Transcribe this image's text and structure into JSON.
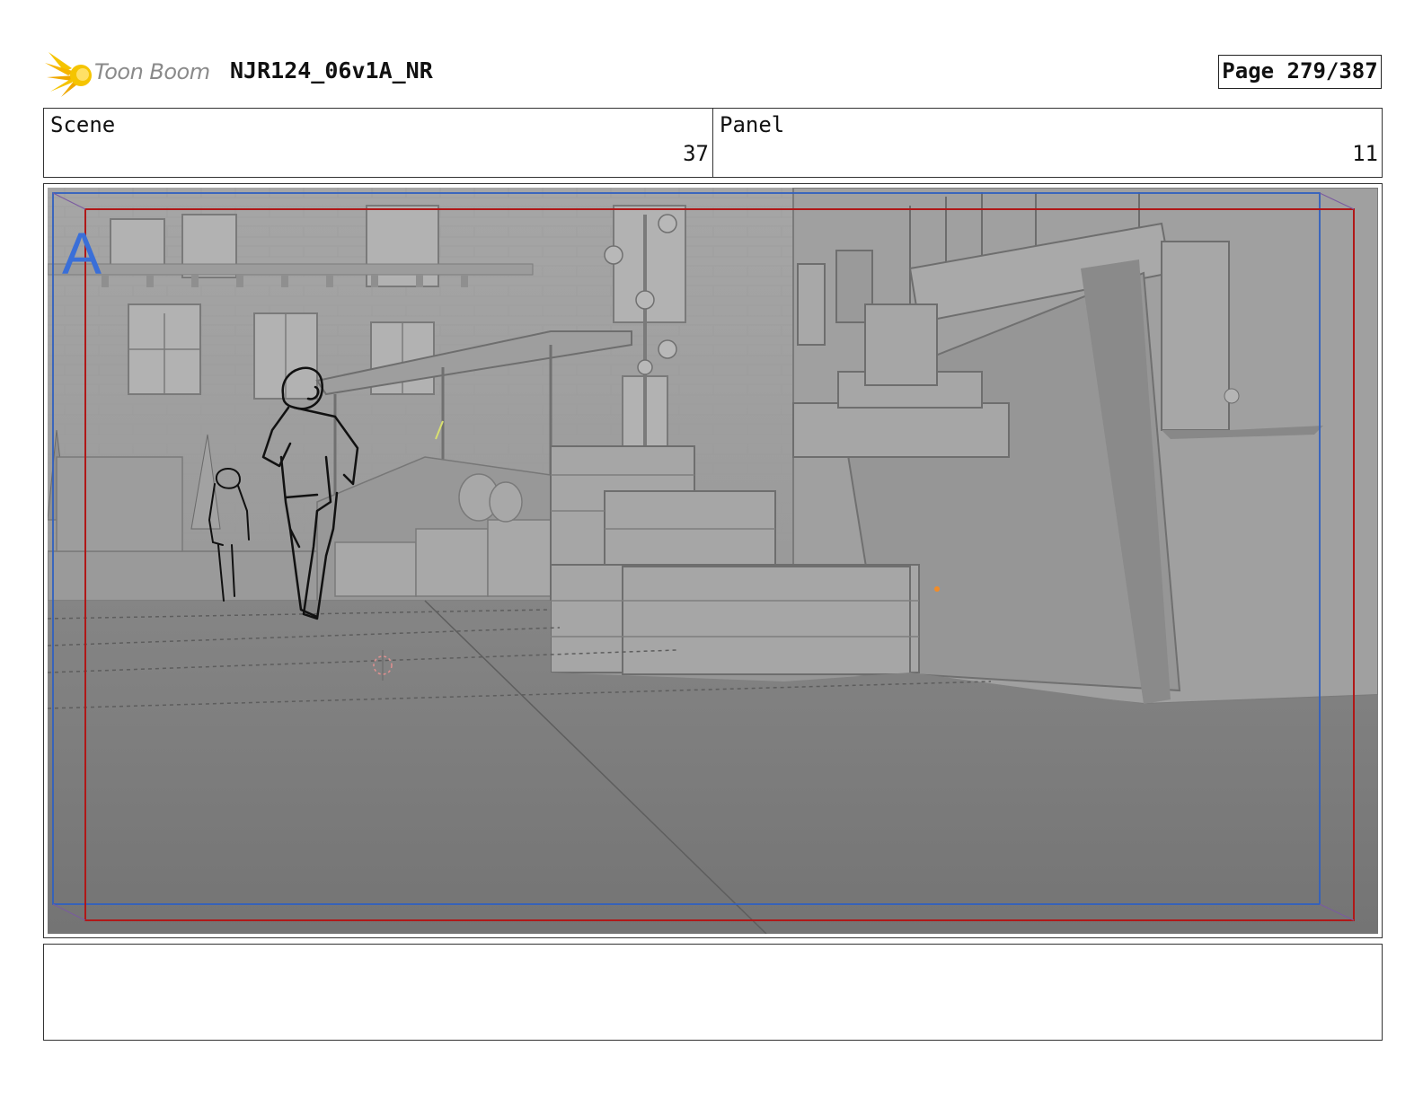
{
  "header": {
    "logo_text": "Toon Boom",
    "title": "NJR124_06v1A_NR",
    "page": "Page 279/387"
  },
  "panel_info": {
    "scene_label": "Scene",
    "scene_value": "37",
    "panel_label": "Panel",
    "panel_value": "11"
  },
  "frame": {
    "camera_marker": "A",
    "safe_frame_color": "#b01818",
    "camera_frame_color": "#3060c0"
  },
  "notes": {
    "text": ""
  }
}
